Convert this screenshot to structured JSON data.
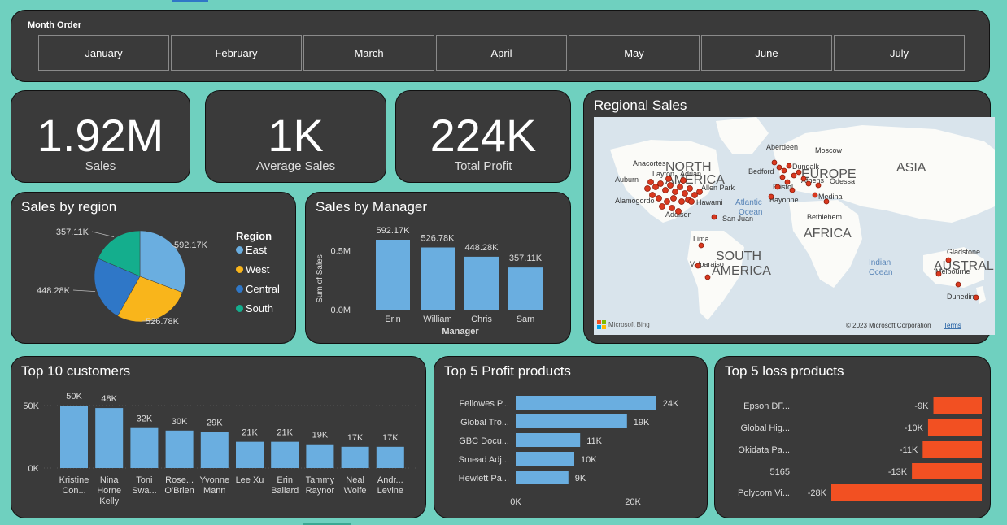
{
  "slicer": {
    "title": "Month Order",
    "months": [
      "January",
      "February",
      "March",
      "April",
      "May",
      "June",
      "July"
    ]
  },
  "kpis": [
    {
      "value": "1.92M",
      "label": "Sales"
    },
    {
      "value": "1K",
      "label": "Average Sales"
    },
    {
      "value": "224K",
      "label": "Total Profit"
    }
  ],
  "map": {
    "title": "Regional Sales",
    "labels": {
      "north_america": "NORTH AMERICA",
      "south_america": "SOUTH AMERICA",
      "europe": "EUROPE",
      "asia": "ASIA",
      "africa": "AFRICA",
      "australia": "AUSTRALIA",
      "atlantic": "Atlantic Ocean",
      "indian": "Indian Ocean"
    },
    "cities": [
      "Anacortes",
      "Auburn",
      "Layton",
      "Adrian",
      "Alamogordo",
      "Allen Park",
      "Hawami",
      "Addison",
      "San Juan",
      "Lima",
      "Valparaiso",
      "Aberdeen",
      "Moscow",
      "Bedford",
      "Dundalk",
      "Bristol",
      "Athens",
      "Odessa",
      "Bayonne",
      "Medina",
      "Bethlehem",
      "Gladstone",
      "Melbourne",
      "Dunedin"
    ],
    "attribution": "Microsoft Bing",
    "copyright": "© 2023 Microsoft Corporation",
    "terms": "Terms"
  },
  "region_chart": {
    "title": "Sales by region",
    "legend_title": "Region",
    "colors": {
      "East": "#6aaee0",
      "West": "#f9b51b",
      "Central": "#2f77c7",
      "South": "#14ae8d"
    },
    "chart_data": {
      "type": "pie",
      "categories": [
        "East",
        "West",
        "Central",
        "South"
      ],
      "values": [
        592.17,
        526.78,
        448.28,
        357.11
      ],
      "labels": [
        "592.17K",
        "526.78K",
        "448.28K",
        "357.11K"
      ],
      "legend": "right"
    }
  },
  "manager_chart": {
    "title": "Sales by Manager",
    "chart_data": {
      "type": "bar",
      "categories": [
        "Erin",
        "William",
        "Chris",
        "Sam"
      ],
      "values": [
        592.17,
        526.78,
        448.28,
        357.11
      ],
      "labels": [
        "592.17K",
        "526.78K",
        "448.28K",
        "357.11K"
      ],
      "xlabel": "Manager",
      "ylabel": "Sum of Sales",
      "ticks": [
        "0.0M",
        "0.5M"
      ],
      "ylim": [
        0,
        700
      ]
    }
  },
  "customers_chart": {
    "title": "Top 10 customers",
    "chart_data": {
      "type": "bar",
      "categories": [
        [
          "Kristine",
          "Con..."
        ],
        [
          "Nina",
          "Horne",
          "Kelly"
        ],
        [
          "Toni",
          "Swa..."
        ],
        [
          "Rose...",
          "O'Brien"
        ],
        [
          "Yvonne",
          "Mann"
        ],
        [
          "Lee Xu"
        ],
        [
          "Erin",
          "Ballard"
        ],
        [
          "Tammy",
          "Raynor"
        ],
        [
          "Neal",
          "Wolfe"
        ],
        [
          "Andr...",
          "Levine"
        ]
      ],
      "values": [
        50,
        48,
        32,
        30,
        29,
        21,
        21,
        19,
        17,
        17
      ],
      "labels": [
        "50K",
        "48K",
        "32K",
        "30K",
        "29K",
        "21K",
        "21K",
        "19K",
        "17K",
        "17K"
      ],
      "ticks": [
        "0K",
        "50K"
      ],
      "ylim": [
        0,
        60
      ]
    }
  },
  "profit_chart": {
    "title": "Top 5 Profit products",
    "chart_data": {
      "type": "bar",
      "categories": [
        "Fellowes P...",
        "Global Tro...",
        "GBC Docu...",
        "Smead Adj...",
        "Hewlett Pa..."
      ],
      "values": [
        24,
        19,
        11,
        10,
        9
      ],
      "labels": [
        "24K",
        "19K",
        "11K",
        "10K",
        "9K"
      ],
      "ticks": [
        "0K",
        "20K"
      ],
      "xlim": [
        0,
        28
      ]
    }
  },
  "loss_chart": {
    "title": "Top 5 loss products",
    "color": "#f25022",
    "chart_data": {
      "type": "bar",
      "categories": [
        "Epson DF...",
        "Global Hig...",
        "Okidata Pa...",
        "5165",
        "Polycom Vi..."
      ],
      "values": [
        -9,
        -10,
        -11,
        -13,
        -28
      ],
      "labels": [
        "-9K",
        "-10K",
        "-11K",
        "-13K",
        "-28K"
      ]
    }
  },
  "bar_color": "#6aaee0"
}
